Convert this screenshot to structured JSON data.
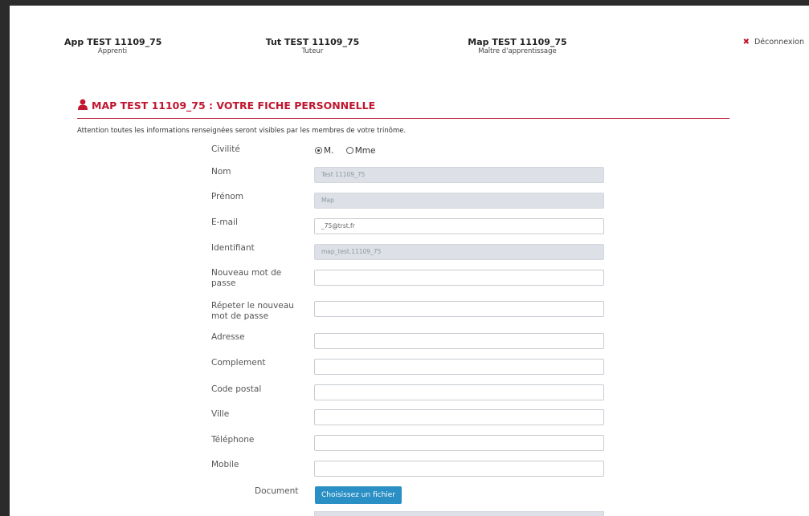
{
  "header": {
    "users": [
      {
        "name": "App TEST 11109_75",
        "role": "Apprenti"
      },
      {
        "name": "Tut TEST 11109_75",
        "role": "Tuteur"
      },
      {
        "name": "Map TEST 11109_75",
        "role": "Maître d'apprentissage"
      }
    ],
    "logout_label": "Déconnexion"
  },
  "section": {
    "title": "MAP TEST 11109_75 : VOTRE FICHE PERSONNELLE",
    "notice": "Attention toutes les informations renseignées seront visibles par les membres de votre trinôme."
  },
  "form": {
    "civilite": {
      "label": "Civilité",
      "options": [
        "M.",
        "Mme"
      ],
      "selected": "M."
    },
    "nom": {
      "label": "Nom",
      "value": "Test 11109_75"
    },
    "prenom": {
      "label": "Prénom",
      "value": "Map"
    },
    "email": {
      "label": "E-mail",
      "value": "_75@trst.fr"
    },
    "identifiant": {
      "label": "Identifiant",
      "value": "map_test.11109_75"
    },
    "new_password": {
      "label": "Nouveau mot de passe",
      "value": ""
    },
    "repeat_password": {
      "label": "Répeter le nouveau mot de passe",
      "value": ""
    },
    "adresse": {
      "label": "Adresse",
      "value": ""
    },
    "complement": {
      "label": "Complement",
      "value": ""
    },
    "code_postal": {
      "label": "Code postal",
      "value": ""
    },
    "ville": {
      "label": "Ville",
      "value": ""
    },
    "telephone": {
      "label": "Téléphone",
      "value": ""
    },
    "mobile": {
      "label": "Mobile",
      "value": ""
    },
    "document": {
      "label": "Document",
      "button_label": "Choisissez un fichier"
    }
  },
  "colors": {
    "accent": "#c0162f",
    "button": "#2a8fc4",
    "readonly_bg": "#dde1e7"
  }
}
